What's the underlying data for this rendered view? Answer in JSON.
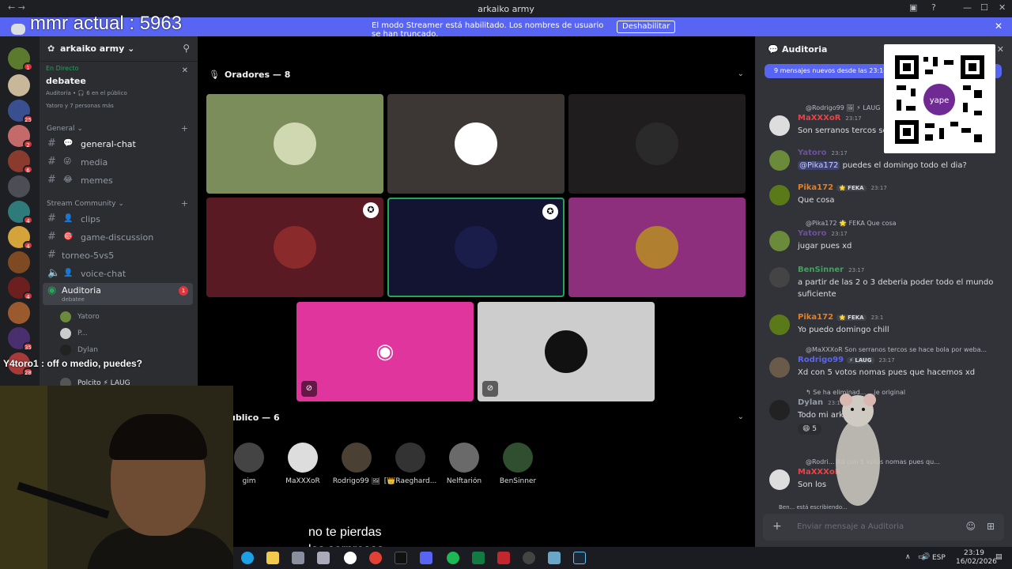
{
  "window": {
    "title": "arkaiko army",
    "nav": "←  →"
  },
  "overlay": {
    "mmr": "mmr actual : 5963",
    "chat_line": "Y4toro1 : off o medio, puedes?",
    "caption_line1": "no te pierdas",
    "caption_line2": "las sorpresas"
  },
  "streamer_bar": {
    "message": "El modo Streamer está habilitado. Los nombres de usuario se han truncado.",
    "button": "Deshabilitar"
  },
  "server": {
    "name": "arkaiko army ⌄"
  },
  "live_event": {
    "label": "En Directo",
    "title": "debatee",
    "sub": "Auditoría • 🎧 6 en el público",
    "users": "Yatoro y 7 personas más"
  },
  "categories": [
    {
      "label": "General ⌄"
    },
    {
      "label": "Stream Community ⌄"
    }
  ],
  "channels": [
    {
      "emoji": "💬",
      "label": "general-chat"
    },
    {
      "emoji": "😜",
      "label": "media"
    },
    {
      "emoji": "😂",
      "label": "memes"
    },
    {
      "emoji": "👤",
      "label": "clips"
    },
    {
      "emoji": "🎯",
      "label": "game-discussion"
    },
    {
      "emoji": "",
      "label": "torneo-5vs5"
    },
    {
      "emoji": "👤",
      "label": "voice-chat"
    },
    {
      "emoji": "",
      "label": "Auditoria",
      "badge": "1",
      "sub": "debatee"
    }
  ],
  "voice_users": [
    "Yatoro",
    "P...",
    "Dylan",
    "Polcito ⚡ LAUG"
  ],
  "guild_badges": [
    "1",
    "",
    "25",
    "2",
    "6",
    "",
    "4",
    "4",
    "",
    "4",
    "",
    "35",
    "28"
  ],
  "stage": {
    "speakers_header": "Oradores — 8",
    "audience_header": "ublico — 6",
    "speaker_colors": [
      "#7b8d5a",
      "#3c3734",
      "#1f1d1e",
      "#5a1a23",
      "#121432",
      "#8e2f7e",
      "#e1359e",
      "#cdcdcd"
    ]
  },
  "audience": [
    "gim",
    "MaXXXoR",
    "Rodrigo99 🖼",
    "[👑Raeghard...",
    "Nelftarión",
    "BenSinner"
  ],
  "chat": {
    "title": "Auditoria",
    "new_banner": "9 mensajes nuevos desde las 23:18",
    "placeholder": "Enviar mensaje a Auditoria",
    "typing": "Ben... está escribiendo...",
    "messages": [
      {
        "reply": "@Rodrigo99 🖼 ⚡ LAUG",
        "name": "MaXXXoR",
        "color": "#f23f43",
        "time": "23:17",
        "tag": "",
        "text": "Son serranos tercos se h"
      },
      {
        "reply": "",
        "name": "Yatoro",
        "color": "#6e4fa3",
        "time": "23:17",
        "tag": "",
        "text_pre": "",
        "mention": "@Pika172",
        "text": " puedes el domingo todo el dia?"
      },
      {
        "reply": "",
        "name": "Pika172",
        "color": "#e67e22",
        "time": "23:17",
        "tag": "🌟 FEKA",
        "text": "Que cosa"
      },
      {
        "reply": "@Pika172 🌟 FEKA  Que cosa",
        "name": "Yatoro",
        "color": "#6e4fa3",
        "time": "23:17",
        "tag": "",
        "text": "jugar pues xd"
      },
      {
        "reply": "",
        "name": "BenSinner",
        "color": "#3ba55c",
        "time": "23:17",
        "tag": "",
        "text": "a partir de las 2 o 3 deberia poder todo el mundo suficiente"
      },
      {
        "reply": "",
        "name": "Pika172",
        "color": "#e67e22",
        "time": "23:1",
        "tag": "🌟 FEKA",
        "text": "Yo puedo domingo chill"
      },
      {
        "reply": "@MaXXXoR Son serranos tercos se hace bola por weba...",
        "name": "Rodrigo99",
        "color": "#5865f2",
        "time": "23:17",
        "tag": "⚡ LAUG",
        "text": "Xd con 5 votos nomas pues que hacemos xd"
      },
      {
        "reply": "↰ Se ha eliminad... ...je original",
        "name": "Dylan",
        "color": "#949ba4",
        "time": "23:17",
        "tag": "",
        "text": "Todo mi arka",
        "reaction": "😄 5"
      },
      {
        "reply": "@Rodri...  Xd con 5 votos nomas pues qu...",
        "name": "MaXXXoR",
        "color": "#f23f43",
        "time": "",
        "tag": "",
        "text": "Son los"
      }
    ]
  },
  "taskbar": {
    "lang": "ESP",
    "time": "23:19",
    "date": "16/02/2026"
  }
}
